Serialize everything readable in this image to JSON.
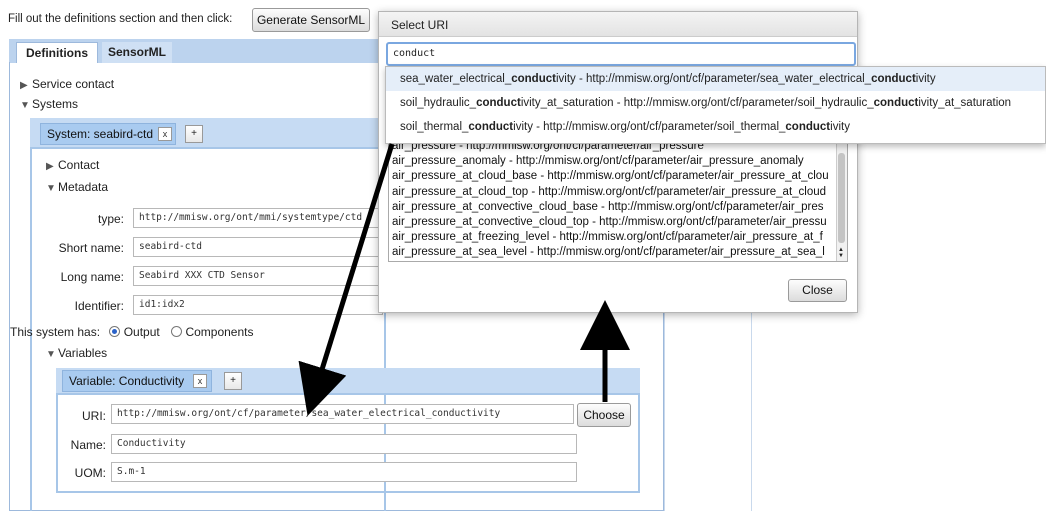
{
  "instruction": "Fill out the definitions section and then click:",
  "generate_button": "Generate SensorML",
  "tabs": [
    {
      "label": "Definitions",
      "active": true
    },
    {
      "label": "SensorML",
      "active": false
    }
  ],
  "tree": {
    "service_contact": "Service contact",
    "systems": "Systems"
  },
  "system": {
    "tab_label": "System: seabird-ctd",
    "remove": "x",
    "add": "+",
    "contact": "Contact",
    "metadata": "Metadata",
    "fields": {
      "type_label": "type:",
      "type_value": "http://mmisw.org/ont/mmi/systemtype/ctd",
      "short_label": "Short name:",
      "short_value": "seabird-ctd",
      "long_label": "Long name:",
      "long_value": "Seabird XXX CTD Sensor",
      "id_label": "Identifier:",
      "id_value": "id1:idx2"
    },
    "has_label": "This system has:",
    "option_output": "Output",
    "option_components": "Components",
    "variables": "Variables"
  },
  "variable": {
    "tab_label": "Variable: Conductivity",
    "remove": "x",
    "add": "+",
    "uri_label": "URI:",
    "uri_value": "http://mmisw.org/ont/cf/parameter/sea_water_electrical_conductivity",
    "choose": "Choose",
    "name_label": "Name:",
    "name_value": "Conductivity",
    "uom_label": "UOM:",
    "uom_value": "S.m-1"
  },
  "dialog": {
    "title": "Select URI",
    "search_value": "conduct",
    "close": "Close",
    "list": [
      "air_pressure - http://mmisw.org/ont/cf/parameter/air_pressure",
      "air_pressure_anomaly - http://mmisw.org/ont/cf/parameter/air_pressure_anomaly",
      "air_pressure_at_cloud_base - http://mmisw.org/ont/cf/parameter/air_pressure_at_clou",
      "air_pressure_at_cloud_top - http://mmisw.org/ont/cf/parameter/air_pressure_at_cloud",
      "air_pressure_at_convective_cloud_base - http://mmisw.org/ont/cf/parameter/air_pres",
      "air_pressure_at_convective_cloud_top - http://mmisw.org/ont/cf/parameter/air_pressu",
      "air_pressure_at_freezing_level - http://mmisw.org/ont/cf/parameter/air_pressure_at_f",
      "air_pressure_at_sea_level - http://mmisw.org/ont/cf/parameter/air_pressure_at_sea_l"
    ],
    "suggestions": [
      {
        "pre": "sea_water_electrical_",
        "match": "conduct",
        "post": "ivity - http://mmisw.org/ont/cf/parameter/sea_water_electrical_",
        "match2": "conduct",
        "post2": "ivity",
        "selected": true
      },
      {
        "pre": "soil_hydraulic_",
        "match": "conduct",
        "post": "ivity_at_saturation - http://mmisw.org/ont/cf/parameter/soil_hydraulic_",
        "match2": "conduct",
        "post2": "ivity_at_saturation",
        "selected": false
      },
      {
        "pre": "soil_thermal_",
        "match": "conduct",
        "post": "ivity - http://mmisw.org/ont/cf/parameter/soil_thermal_",
        "match2": "conduct",
        "post2": "ivity",
        "selected": false
      }
    ]
  },
  "colors": {
    "panel_border": "#a7c6e8",
    "tab_bar": "#bcd3ee",
    "pill": "#a9cbf0",
    "arrow": "#000000"
  }
}
